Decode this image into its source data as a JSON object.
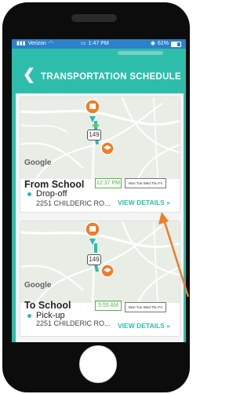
{
  "status_bar": {
    "carrier": "Verizon",
    "time": "1:47 PM",
    "battery": "61%"
  },
  "header": {
    "title": "TRANSPORTATION SCHEDULE"
  },
  "cards": [
    {
      "route_shield": "149",
      "map_attribution": "Google",
      "title": "From School",
      "type": "Drop-off",
      "address": "2251 CHILDERIC RO...",
      "time": "12:37 PM",
      "days": "Mon Tue Wed Thu Fri",
      "view_details": "VIEW DETAILS »"
    },
    {
      "route_shield": "149",
      "map_attribution": "Google",
      "title": "To School",
      "type": "Pick-up",
      "address": "2251 CHILDERIC RO...",
      "time": "5:55 AM",
      "days": "Mon Tue Wed Thu Fri",
      "view_details": "VIEW DETAILS »"
    }
  ],
  "colors": {
    "accent": "#2ebdaa",
    "marker": "#f07c2a",
    "arrow": "#f07c2a",
    "status_bar": "#2c82c9"
  }
}
